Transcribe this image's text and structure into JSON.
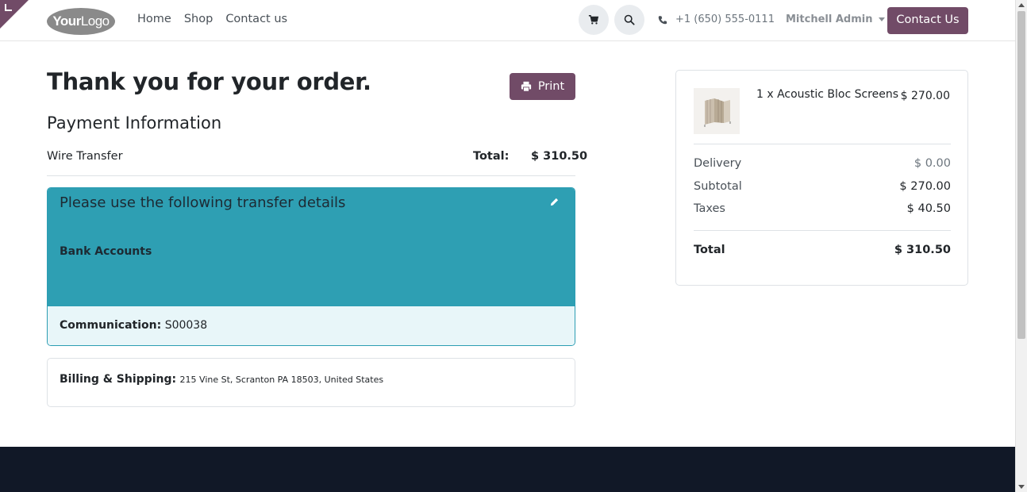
{
  "header": {
    "logo_text_bold": "Your",
    "logo_text_rest": "Logo",
    "nav": [
      {
        "label": "Home"
      },
      {
        "label": "Shop"
      },
      {
        "label": "Contact us"
      }
    ],
    "phone": "+1 (650) 555-0111",
    "user": "Mitchell Admin",
    "contact_button": "Contact Us",
    "icons": {
      "cart": "cart-icon",
      "search": "search-icon",
      "phone": "phone-icon"
    }
  },
  "main": {
    "title": "Thank you for your order.",
    "print_label": "Print",
    "payment_title": "Payment Information",
    "payment_method": "Wire Transfer",
    "total_label": "Total:",
    "total_value": "$ 310.50",
    "transfer": {
      "title": "Please use the following transfer details",
      "bank_label": "Bank Accounts",
      "communication_label": "Communication:",
      "communication_value": "S00038"
    },
    "billing": {
      "label": "Billing & Shipping:",
      "address": "215 Vine St, Scranton PA 18503, United States"
    }
  },
  "summary": {
    "item": {
      "name": "1 x Acoustic Bloc Screens",
      "price": "$ 270.00"
    },
    "rows": {
      "delivery": {
        "label": "Delivery",
        "value": "$ 0.00"
      },
      "subtotal": {
        "label": "Subtotal",
        "value": "$ 270.00"
      },
      "taxes": {
        "label": "Taxes",
        "value": "$ 40.50"
      },
      "total": {
        "label": "Total",
        "value": "$ 310.50"
      }
    }
  },
  "colors": {
    "brand": "#714b67",
    "info_banner": "#2e9fb3",
    "footer": "#111827"
  }
}
